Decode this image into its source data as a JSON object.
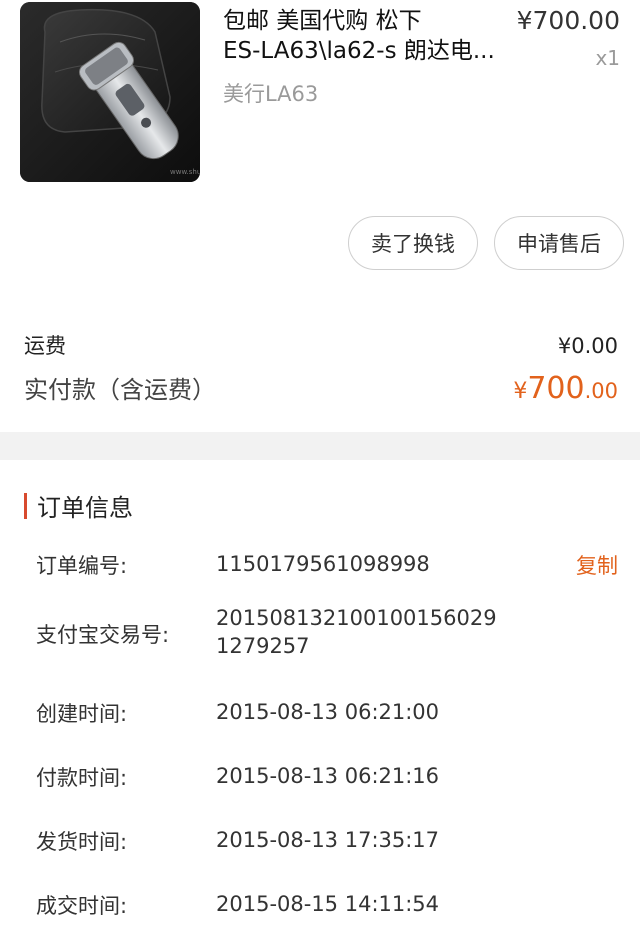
{
  "product": {
    "title_line1": "包邮 美国代购 松下",
    "title_line2": "ES-LA63\\la62-s 朗达电...",
    "spec": "美行LA63",
    "price": "¥700.00",
    "quantity": "x1"
  },
  "actions": {
    "sell_label": "卖了换钱",
    "aftersale_label": "申请售后"
  },
  "totals": {
    "shipping_label": "运费",
    "shipping_value": "¥0.00",
    "paid_label": "实付款（含运费）",
    "paid_currency": "¥",
    "paid_integer": "700",
    "paid_decimal": ".00"
  },
  "order_info": {
    "title": "订单信息",
    "copy_label": "复制",
    "rows": [
      {
        "label": "订单编号:",
        "value": "1150179561098998"
      },
      {
        "label": "支付宝交易号:",
        "value_line1": "20150813210010015602​9",
        "value_line2": "1279257"
      },
      {
        "label": "创建时间:",
        "value": "2015-08-13 06:21:00"
      },
      {
        "label": "付款时间:",
        "value": "2015-08-13 06:21:16"
      },
      {
        "label": "发货时间:",
        "value": "2015-08-13 17:35:17"
      },
      {
        "label": "成交时间:",
        "value": "2015-08-15 14:11:54"
      }
    ]
  },
  "colors": {
    "accent": "#e2621c",
    "bar": "#d84a2e"
  }
}
